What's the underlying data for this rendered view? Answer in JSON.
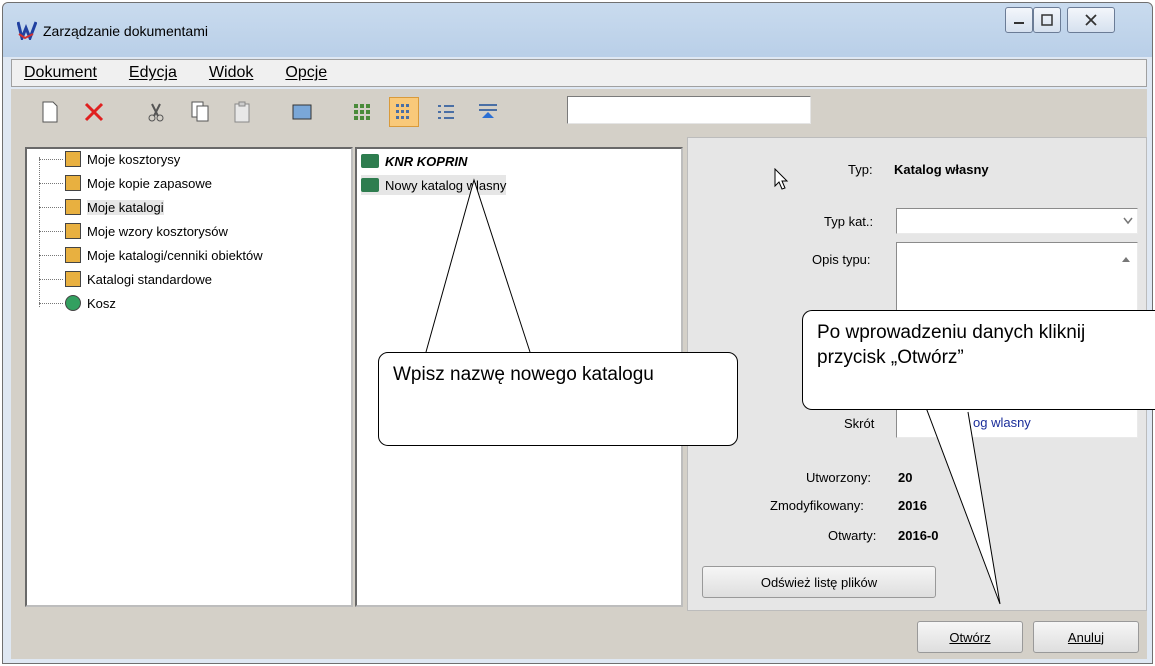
{
  "window": {
    "title": "Zarządzanie dokumentami"
  },
  "menu": {
    "items": [
      "Dokument",
      "Edycja",
      "Widok",
      "Opcje"
    ]
  },
  "toolbar": {
    "search_value": ""
  },
  "tree": {
    "items": [
      {
        "label": "Moje kosztorysy",
        "icon": "folder-estimate-icon"
      },
      {
        "label": "Moje kopie zapasowe",
        "icon": "folder-backup-icon"
      },
      {
        "label": "Moje katalogi",
        "icon": "folder-catalog-icon"
      },
      {
        "label": "Moje wzory kosztorysów",
        "icon": "folder-template-icon"
      },
      {
        "label": "Moje katalogi/cenniki obiektów",
        "icon": "folder-pricelist-icon"
      },
      {
        "label": "Katalogi standardowe",
        "icon": "folder-standard-icon"
      },
      {
        "label": "Kosz",
        "icon": "recycle-bin-icon"
      }
    ]
  },
  "list": {
    "items": [
      {
        "label": "KNR KOPRIN",
        "bold": true
      },
      {
        "label": "Nowy katalog wlasny",
        "bold": false
      }
    ]
  },
  "props": {
    "typ_label": "Typ:",
    "typ_value": "Katalog własny",
    "typ_kat_label": "Typ kat.:",
    "opis_label": "Opis typu:",
    "skrot_label": "Skrót",
    "skrot_value": "og wlasny",
    "utworzony_label": "Utworzony:",
    "utworzony_value": "20",
    "zmodyfikowany_label": "Zmodyfikowany:",
    "zmodyfikowany_value": "2016",
    "otwarty_label": "Otwarty:",
    "otwarty_value": "2016-0"
  },
  "buttons": {
    "refresh": "Odśwież listę plików",
    "open": "Otwórz",
    "cancel": "Anuluj"
  },
  "callouts": {
    "left": "Wpisz nazwę nowego katalogu",
    "right": "Po wprowadzeniu danych kliknij przycisk „Otwórz”"
  }
}
